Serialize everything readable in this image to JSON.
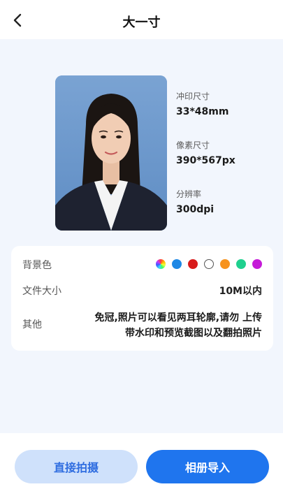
{
  "header": {
    "title": "大一寸",
    "back_icon": "chevron-left-icon"
  },
  "specs": [
    {
      "label": "冲印尺寸",
      "value": "33*48mm"
    },
    {
      "label": "像素尺寸",
      "value": "390*567px"
    },
    {
      "label": "分辨率",
      "value": "300dpi"
    }
  ],
  "details": {
    "background_label": "背景色",
    "background_colors": [
      "rainbow",
      "#1e88e5",
      "#d81b1b",
      "#ffffff",
      "#f7931e",
      "#1fd08e",
      "#c51bd8"
    ],
    "file_size_label": "文件大小",
    "file_size_value": "10M以内",
    "other_label": "其他",
    "other_value": "免冠,照片可以看见两耳轮廓,请勿 上传带水印和预览截图以及翻拍照片"
  },
  "actions": {
    "camera_label": "直接拍摄",
    "album_label": "相册导入"
  },
  "colors": {
    "accent": "#1f75ee",
    "accent_light": "#cfe1fb",
    "page_bg": "#f2f6fd"
  }
}
